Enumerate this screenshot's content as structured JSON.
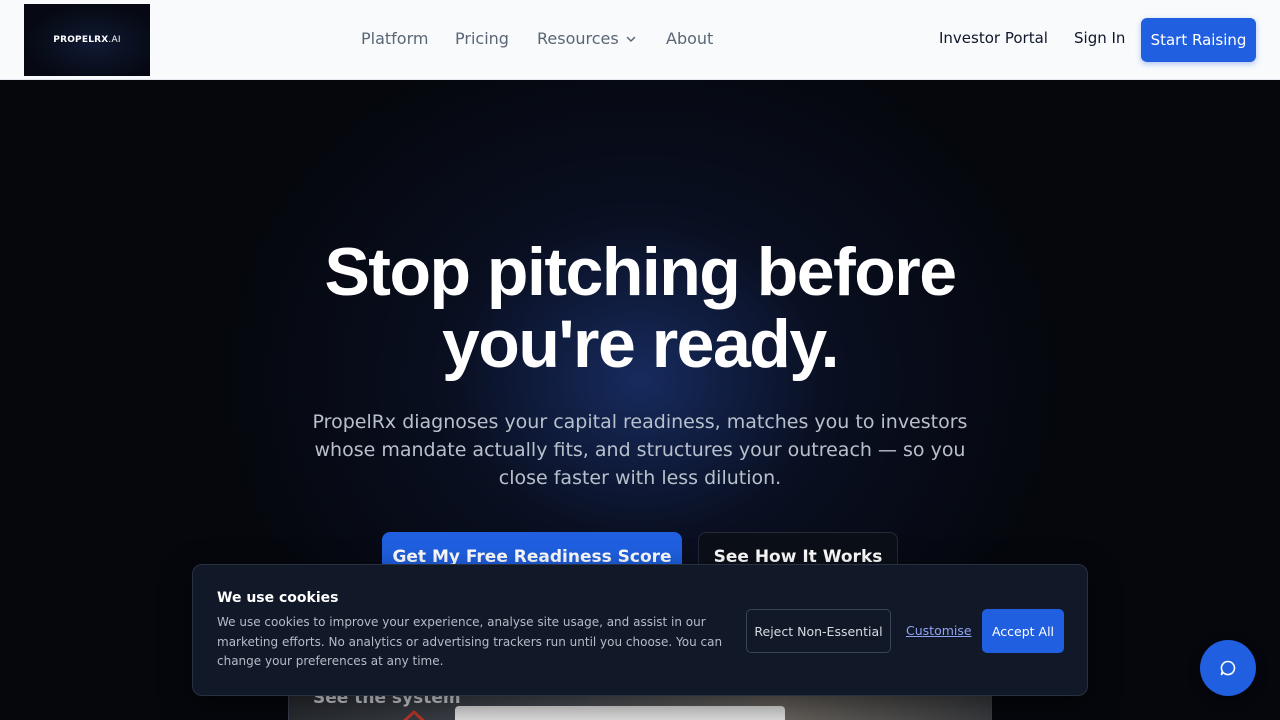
{
  "header": {
    "logo": {
      "bold": "PROPELRX",
      "thin": ".AI"
    },
    "nav": [
      {
        "label": "Platform"
      },
      {
        "label": "Pricing"
      },
      {
        "label": "Resources",
        "has_dropdown": true
      },
      {
        "label": "About"
      }
    ],
    "investor_portal": "Investor Portal",
    "sign_in": "Sign In",
    "cta": "Start Raising"
  },
  "hero": {
    "title_line1": "Stop pitching before",
    "title_line2": "you're ready.",
    "subtitle": "PropelRx diagnoses your capital readiness, matches you to investors whose mandate actually fits, and structures your outreach — so you close faster with less dilution.",
    "primary_cta": "Get My Free Readiness Score",
    "secondary_cta": "See How It Works",
    "preview_label": "See the system"
  },
  "cookie": {
    "title": "We use cookies",
    "text": "We use cookies to improve your experience, analyse site usage, and assist in our marketing efforts. No analytics or advertising trackers run until you choose. You can change your preferences at any time.",
    "reject": "Reject Non-Essential",
    "customise": "Customise",
    "accept": "Accept All"
  },
  "chat": {
    "icon": "chat-bubble-icon"
  },
  "colors": {
    "accent": "#1f5fe0",
    "hero_bg": "#05070d",
    "header_bg": "#f8fafc"
  }
}
